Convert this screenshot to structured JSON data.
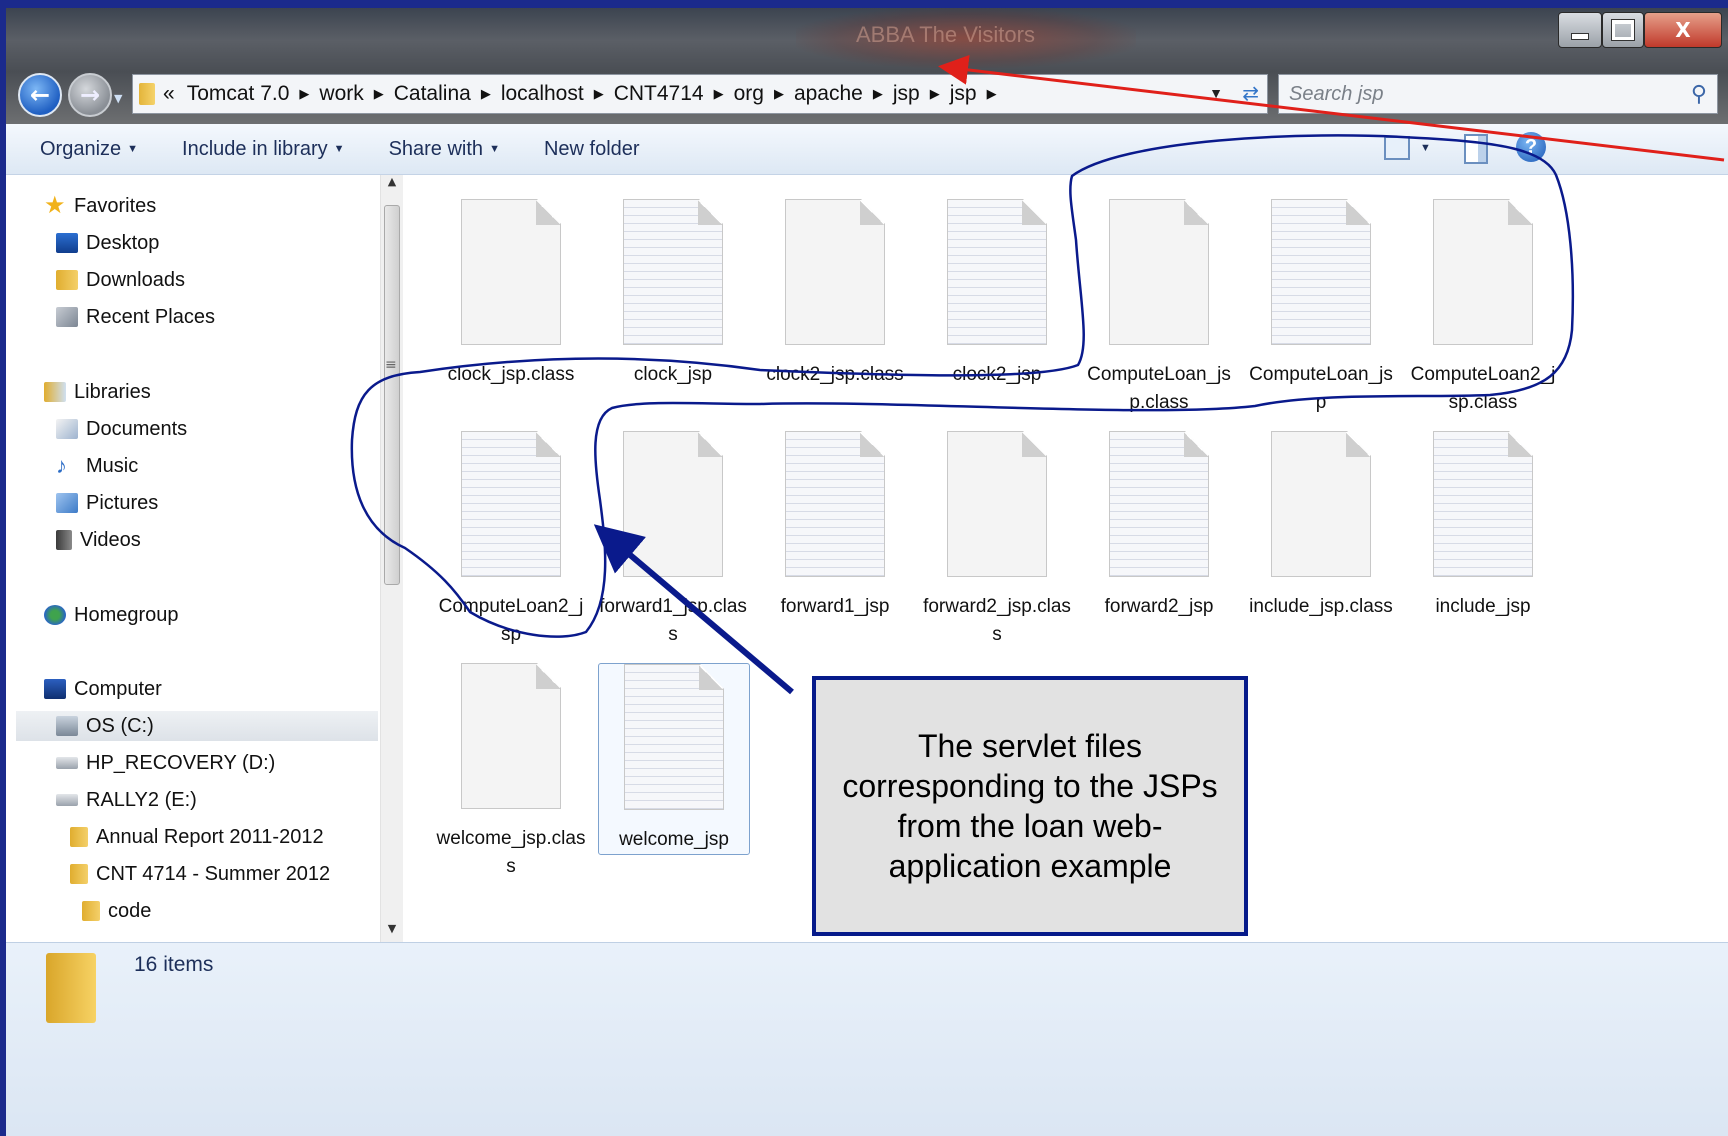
{
  "window": {
    "title_text": "ABBA The Visitors",
    "controls": {
      "minimize": "",
      "maximize": "",
      "close": "X"
    }
  },
  "address_bar": {
    "overflow": "«",
    "crumbs": [
      "Tomcat 7.0",
      "work",
      "Catalina",
      "localhost",
      "CNT4714",
      "org",
      "apache",
      "jsp",
      "jsp"
    ]
  },
  "search": {
    "placeholder": "Search jsp"
  },
  "toolbar": {
    "organize": "Organize",
    "include_in_library": "Include in library",
    "share_with": "Share with",
    "new_folder": "New folder",
    "help": "?"
  },
  "nav_pane": {
    "favorites": "Favorites",
    "desktop": "Desktop",
    "downloads": "Downloads",
    "recent_places": "Recent Places",
    "libraries": "Libraries",
    "documents": "Documents",
    "music": "Music",
    "pictures": "Pictures",
    "videos": "Videos",
    "homegroup": "Homegroup",
    "computer": "Computer",
    "os_c": "OS (C:)",
    "hp_recovery": "HP_RECOVERY (D:)",
    "rally2": "RALLY2 (E:)",
    "annual_report": "Annual Report 2011-2012",
    "cnt4714": "CNT 4714 - Summer 2012",
    "code": "code"
  },
  "files": [
    {
      "name": "clock_jsp.class",
      "lined": false
    },
    {
      "name": "clock_jsp",
      "lined": true
    },
    {
      "name": "clock2_jsp.class",
      "lined": false
    },
    {
      "name": "clock2_jsp",
      "lined": true
    },
    {
      "name": "ComputeLoan_jsp.class",
      "lined": false
    },
    {
      "name": "ComputeLoan_jsp",
      "lined": true
    },
    {
      "name": "ComputeLoan2_jsp.class",
      "lined": false
    },
    {
      "name": "ComputeLoan2_jsp",
      "lined": true
    },
    {
      "name": "forward1_jsp.class",
      "lined": false
    },
    {
      "name": "forward1_jsp",
      "lined": true
    },
    {
      "name": "forward2_jsp.class",
      "lined": false
    },
    {
      "name": "forward2_jsp",
      "lined": true
    },
    {
      "name": "include_jsp.class",
      "lined": false
    },
    {
      "name": "include_jsp",
      "lined": true
    },
    {
      "name": "welcome_jsp.class",
      "lined": false
    },
    {
      "name": "welcome_jsp",
      "lined": true
    }
  ],
  "status": {
    "item_count": "16 items"
  },
  "callout": {
    "text": "The servlet files corresponding to the JSPs from the loan web-application example"
  },
  "colors": {
    "slide_bg": "#1b2a8c",
    "annotation_ink": "#0a1a8c",
    "pointer_red": "#e0201a",
    "callout_border": "#061a8a"
  }
}
